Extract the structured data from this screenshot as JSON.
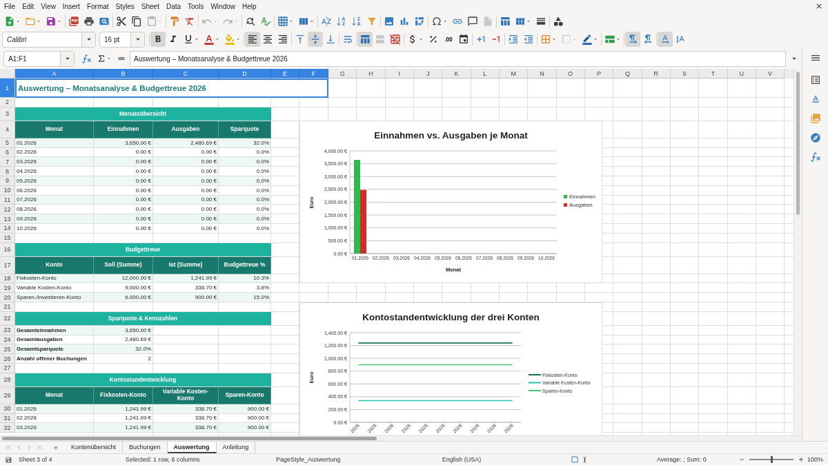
{
  "menu_bar": [
    "File",
    "Edit",
    "View",
    "Insert",
    "Format",
    "Styles",
    "Sheet",
    "Data",
    "Tools",
    "Window",
    "Help"
  ],
  "standard_toolbar": [
    {
      "disabled": false
    },
    {
      "disabled": false
    },
    {
      "disabled": false
    },
    {
      "disabled": false
    },
    {
      "disabled": false
    },
    {
      "disabled": false
    },
    {
      "disabled": false
    },
    {
      "disabled": false
    },
    {
      "disabled": true
    },
    {
      "disabled": false
    },
    {
      "disabled": false
    },
    {
      "disabled": true
    },
    {
      "disabled": true
    },
    {
      "disabled": false
    },
    {
      "disabled": false
    },
    {
      "disabled": false
    },
    {
      "disabled": false
    },
    {
      "disabled": false
    },
    {
      "disabled": false
    },
    {
      "disabled": false
    },
    {
      "disabled": false
    },
    {
      "disabled": false
    },
    {
      "disabled": false
    },
    {
      "disabled": false
    },
    {
      "disabled": false
    },
    {
      "disabled": false
    },
    {
      "disabled": false
    },
    {
      "disabled": true
    },
    {
      "disabled": false
    },
    {
      "disabled": false
    },
    {
      "disabled": false
    },
    {
      "disabled": false
    }
  ],
  "formatting_toolbar": {
    "font_name": "Calibri",
    "font_size": "16 pt",
    "buttons": [
      {
        "on": true,
        "disabled": false
      },
      {
        "on": false,
        "disabled": false
      },
      {
        "on": false,
        "disabled": false
      },
      {
        "on": false,
        "disabled": false
      },
      {
        "on": false,
        "disabled": false
      },
      {
        "on": true,
        "disabled": false
      },
      {
        "on": false,
        "disabled": false
      },
      {
        "on": false,
        "disabled": false
      },
      {
        "on": false,
        "disabled": false
      },
      {
        "on": true,
        "disabled": false
      },
      {
        "on": false,
        "disabled": false
      },
      {
        "on": false,
        "disabled": false
      },
      {
        "on": true,
        "disabled": false
      },
      {
        "on": false,
        "disabled": true
      },
      {
        "on": false,
        "disabled": false
      },
      {
        "on": false,
        "disabled": false
      },
      {
        "on": false,
        "disabled": false
      },
      {
        "on": false,
        "disabled": false
      },
      {
        "on": false,
        "disabled": false
      },
      {
        "on": false,
        "disabled": false
      },
      {
        "on": false,
        "disabled": false
      },
      {
        "on": false,
        "disabled": false
      },
      {
        "on": false,
        "disabled": false
      },
      {
        "on": false,
        "disabled": false
      },
      {
        "on": false,
        "disabled": true
      },
      {
        "on": false,
        "disabled": false
      },
      {
        "on": false,
        "disabled": false
      },
      {
        "on": true,
        "disabled": false
      },
      {
        "on": false,
        "disabled": false
      },
      {
        "on": true,
        "disabled": false
      },
      {
        "on": false,
        "disabled": false
      }
    ]
  },
  "formula_bar": {
    "name_box": "A1:F1",
    "formula": "Auswertung – Monatsanalyse & Budgettreue 2026"
  },
  "sheet": {
    "columns": [
      {
        "label": "A",
        "selected": true
      },
      {
        "label": "B",
        "selected": true
      },
      {
        "label": "C",
        "selected": true
      },
      {
        "label": "D",
        "selected": true
      },
      {
        "label": "E",
        "selected": true
      },
      {
        "label": "F",
        "selected": true
      },
      {
        "label": "G",
        "selected": false
      },
      {
        "label": "H",
        "selected": false
      },
      {
        "label": "I",
        "selected": false
      },
      {
        "label": "J",
        "selected": false
      },
      {
        "label": "K",
        "selected": false
      },
      {
        "label": "L",
        "selected": false
      },
      {
        "label": "M",
        "selected": false
      },
      {
        "label": "N",
        "selected": false
      },
      {
        "label": "O",
        "selected": false
      },
      {
        "label": "P",
        "selected": false
      },
      {
        "label": "Q",
        "selected": false
      },
      {
        "label": "R",
        "selected": false
      },
      {
        "label": "S",
        "selected": false
      },
      {
        "label": "T",
        "selected": false
      },
      {
        "label": "U",
        "selected": false
      },
      {
        "label": "V",
        "selected": false
      }
    ],
    "rows": [
      {
        "label": "1",
        "selected": true
      },
      {
        "label": "2",
        "selected": false
      },
      {
        "label": "3",
        "selected": false
      },
      {
        "label": "4",
        "selected": false
      },
      {
        "label": "5",
        "selected": false
      },
      {
        "label": "6",
        "selected": false
      },
      {
        "label": "7",
        "selected": false
      },
      {
        "label": "8",
        "selected": false
      },
      {
        "label": "9",
        "selected": false
      },
      {
        "label": "10",
        "selected": false
      },
      {
        "label": "11",
        "selected": false
      },
      {
        "label": "12",
        "selected": false
      },
      {
        "label": "13",
        "selected": false
      },
      {
        "label": "14",
        "selected": false
      },
      {
        "label": "15",
        "selected": false
      },
      {
        "label": "16",
        "selected": false
      },
      {
        "label": "17",
        "selected": false
      },
      {
        "label": "18",
        "selected": false
      },
      {
        "label": "19",
        "selected": false
      },
      {
        "label": "20",
        "selected": false
      },
      {
        "label": "21",
        "selected": false
      },
      {
        "label": "22",
        "selected": false
      },
      {
        "label": "23",
        "selected": false
      },
      {
        "label": "24",
        "selected": false
      },
      {
        "label": "25",
        "selected": false
      },
      {
        "label": "26",
        "selected": false
      },
      {
        "label": "27",
        "selected": false
      },
      {
        "label": "28",
        "selected": false
      },
      {
        "label": "29",
        "selected": false
      },
      {
        "label": "30",
        "selected": false
      },
      {
        "label": "31",
        "selected": false
      },
      {
        "label": "32",
        "selected": false
      }
    ],
    "title": "Auswertung – Monatsanalyse & Budgettreue 2026",
    "sections": [
      {
        "kind": "table",
        "title": "Monatsübersicht",
        "columns": [
          "Monat",
          "Einnahmen",
          "Ausgaben",
          "Sparquote"
        ],
        "rows": [
          [
            "01.2026",
            "3,650.00 €",
            "2,480.69 €",
            "32.0%"
          ],
          [
            "02.2026",
            "0.00 €",
            "0.00 €",
            "0.0%"
          ],
          [
            "03.2026",
            "0.00 €",
            "0.00 €",
            "0.0%"
          ],
          [
            "04.2026",
            "0.00 €",
            "0.00 €",
            "0.0%"
          ],
          [
            "05.2026",
            "0.00 €",
            "0.00 €",
            "0.0%"
          ],
          [
            "06.2026",
            "0.00 €",
            "0.00 €",
            "0.0%"
          ],
          [
            "07.2026",
            "0.00 €",
            "0.00 €",
            "0.0%"
          ],
          [
            "08.2026",
            "0.00 €",
            "0.00 €",
            "0.0%"
          ],
          [
            "09.2026",
            "0.00 €",
            "0.00 €",
            "0.0%"
          ],
          [
            "10.2026",
            "0.00 €",
            "0.00 €",
            "0.0%"
          ]
        ]
      },
      {
        "kind": "table",
        "title": "Budgettreue",
        "columns": [
          "Konto",
          "Soll (Summe)",
          "Ist (Summe)",
          "Budgettreue %"
        ],
        "rows": [
          [
            "Fixkosten-Konto",
            "12,000.00 €",
            "1,241.99 €",
            "10.3%"
          ],
          [
            "Variable Kosten-Konto",
            "9,000.00 €",
            "338.70 €",
            "3.8%"
          ],
          [
            "Sparen-/Investieren-Konto",
            "6,000.00 €",
            "900.00 €",
            "15.0%"
          ]
        ]
      },
      {
        "kind": "key_figures",
        "title": "Sparquote & Kennzahlen",
        "rows": [
          [
            "Gesamteinnahmen",
            "3,650.00 €"
          ],
          [
            "Gesamtausgaben",
            "2,480.69 €"
          ],
          [
            "Gesamtsparquote",
            "32.0%"
          ],
          [
            "Anzahl offener Buchungen",
            "2"
          ]
        ]
      },
      {
        "kind": "table",
        "title": "Kontostandentwicklung",
        "columns": [
          "Monat",
          "Fixkosten-Konto",
          "Variable Kosten-Konto",
          "Sparen-Konto"
        ],
        "rows": [
          [
            "01.2026",
            "1,241.99 €",
            "338.70 €",
            "900.00 €"
          ],
          [
            "02.2026",
            "1,241.99 €",
            "338.70 €",
            "900.00 €"
          ],
          [
            "03.2026",
            "1,241.99 €",
            "338.70 €",
            "900.00 €"
          ]
        ]
      }
    ]
  },
  "charts": [
    {
      "chart_data": {
        "type": "bar",
        "title": "Einnahmen vs. Ausgaben je Monat",
        "xlabel": "Monat",
        "ylabel": "Euro",
        "categories": [
          "01.2026",
          "02.2026",
          "03.2026",
          "04.2026",
          "05.2026",
          "06.2026",
          "07.2026",
          "08.2026",
          "09.2026",
          "10.2026"
        ],
        "series": [
          {
            "name": "Einnahmen",
            "color": "#2dbb4e",
            "values": [
              3650,
              0,
              0,
              0,
              0,
              0,
              0,
              0,
              0,
              0
            ]
          },
          {
            "name": "Ausgaben",
            "color": "#d42b2b",
            "values": [
              2480,
              0,
              0,
              0,
              0,
              0,
              0,
              0,
              0,
              0
            ]
          }
        ],
        "ylim": [
          0,
          4000
        ],
        "yticks": [
          {
            "value": 0,
            "label": "0.00 €"
          },
          {
            "value": 500,
            "label": "500.00 €"
          },
          {
            "value": 1000,
            "label": "1,000.00 €"
          },
          {
            "value": 1500,
            "label": "1,500.00 €"
          },
          {
            "value": 2000,
            "label": "2,000.00 €"
          },
          {
            "value": 2500,
            "label": "2,500.00 €"
          },
          {
            "value": 3000,
            "label": "3,000.00 €"
          },
          {
            "value": 3500,
            "label": "3,500.00 €"
          },
          {
            "value": 4000,
            "label": "4,000.00 €"
          }
        ],
        "grid": true,
        "legend": "right"
      }
    },
    {
      "chart_data": {
        "type": "line",
        "title": "Kontostandentwicklung der drei Konten",
        "ylabel": "Euro",
        "categories": [
          "2026",
          "2026",
          "2026",
          "2026",
          "2026",
          "2026",
          "2026",
          "2026",
          "2026",
          "2026"
        ],
        "series": [
          {
            "name": "Fixkosten-Konto",
            "color": "#17705f",
            "values": [
              1240,
              1240,
              1240,
              1240,
              1240,
              1240,
              1240,
              1240,
              1240,
              1240
            ]
          },
          {
            "name": "Variable Kosten-Konto",
            "color": "#1fc1a9",
            "values": [
              340,
              340,
              340,
              340,
              340,
              340,
              340,
              340,
              340,
              340
            ]
          },
          {
            "name": "Sparen-Konto",
            "color": "#3ac46f",
            "values": [
              900,
              900,
              900,
              900,
              900,
              900,
              900,
              900,
              900,
              900
            ]
          }
        ],
        "ylim": [
          0,
          1400
        ],
        "yticks": [
          {
            "value": 0,
            "label": "0.00 €"
          },
          {
            "value": 200,
            "label": "200.00 €"
          },
          {
            "value": 400,
            "label": "400.00 €"
          },
          {
            "value": 600,
            "label": "600.00 €"
          },
          {
            "value": 800,
            "label": "800.00 €"
          },
          {
            "value": 1000,
            "label": "1,000.00 €"
          },
          {
            "value": 1200,
            "label": "1,200.00 €"
          },
          {
            "value": 1400,
            "label": "1,400.00 €"
          }
        ],
        "grid": true,
        "legend": "right"
      }
    }
  ],
  "sheet_navigation": [
    {
      "disabled": true
    },
    {
      "disabled": true
    },
    {
      "disabled": true
    },
    {
      "disabled": true
    }
  ],
  "sheet_tabs": [
    {
      "label": "Kontenübersicht",
      "selected": false
    },
    {
      "label": "Buchungen",
      "selected": false
    },
    {
      "label": "Auswertung",
      "selected": true
    },
    {
      "label": "Anleitung",
      "selected": false
    }
  ],
  "status_bar": {
    "sheet": "Sheet 3 of 4",
    "selection": "Selected: 1 row, 6 columns",
    "page_style": "PageStyle_Auswertung",
    "language": "English (USA)",
    "summary": "Average: ; Sum: 0",
    "zoom_slider": {
      "level": 0.5
    },
    "zoom": "100%"
  }
}
